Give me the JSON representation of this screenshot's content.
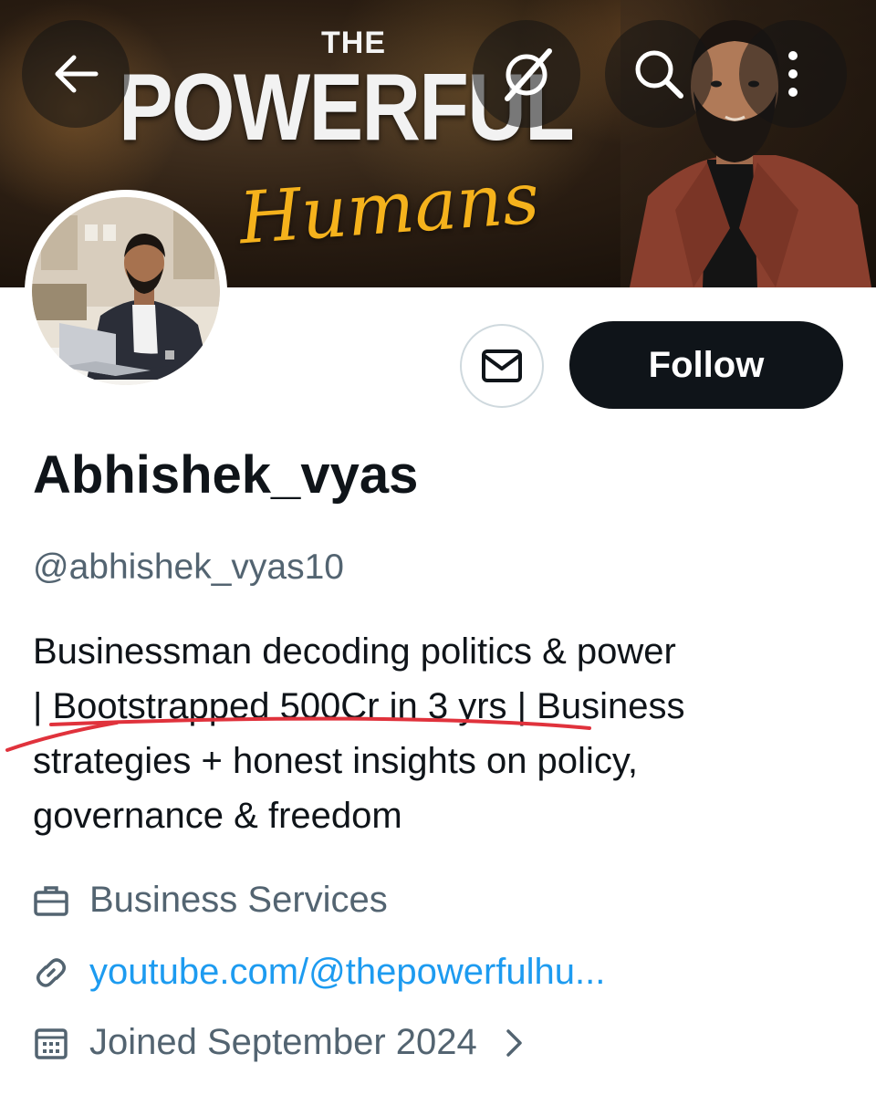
{
  "banner": {
    "logo_top": "THE",
    "logo_main": "POWERFUL",
    "logo_script": "Humans"
  },
  "toolbar": {
    "back_icon": "arrow-left-icon",
    "grok_icon": "grok-icon",
    "search_icon": "search-icon",
    "more_icon": "more-vertical-icon"
  },
  "profile": {
    "display_name": "Abhishek_vyas",
    "handle": "@abhishek_vyas10",
    "bio_lines": [
      "Businessman decoding politics & power",
      "| Bootstrapped 500Cr in 3 yrs | Business",
      "strategies + honest insights on policy,",
      "governance & freedom"
    ],
    "category": "Business Services",
    "link": "youtube.com/@thepowerfulhu...",
    "joined": "Joined September 2024"
  },
  "actions": {
    "message_icon": "envelope-icon",
    "follow_label": "Follow"
  },
  "colors": {
    "accent_link": "#1d9bf0",
    "follow_bg": "#0f1419",
    "secondary_text": "#536471",
    "annotation_red": "#e0323c",
    "logo_gold": "#f5b21c"
  }
}
